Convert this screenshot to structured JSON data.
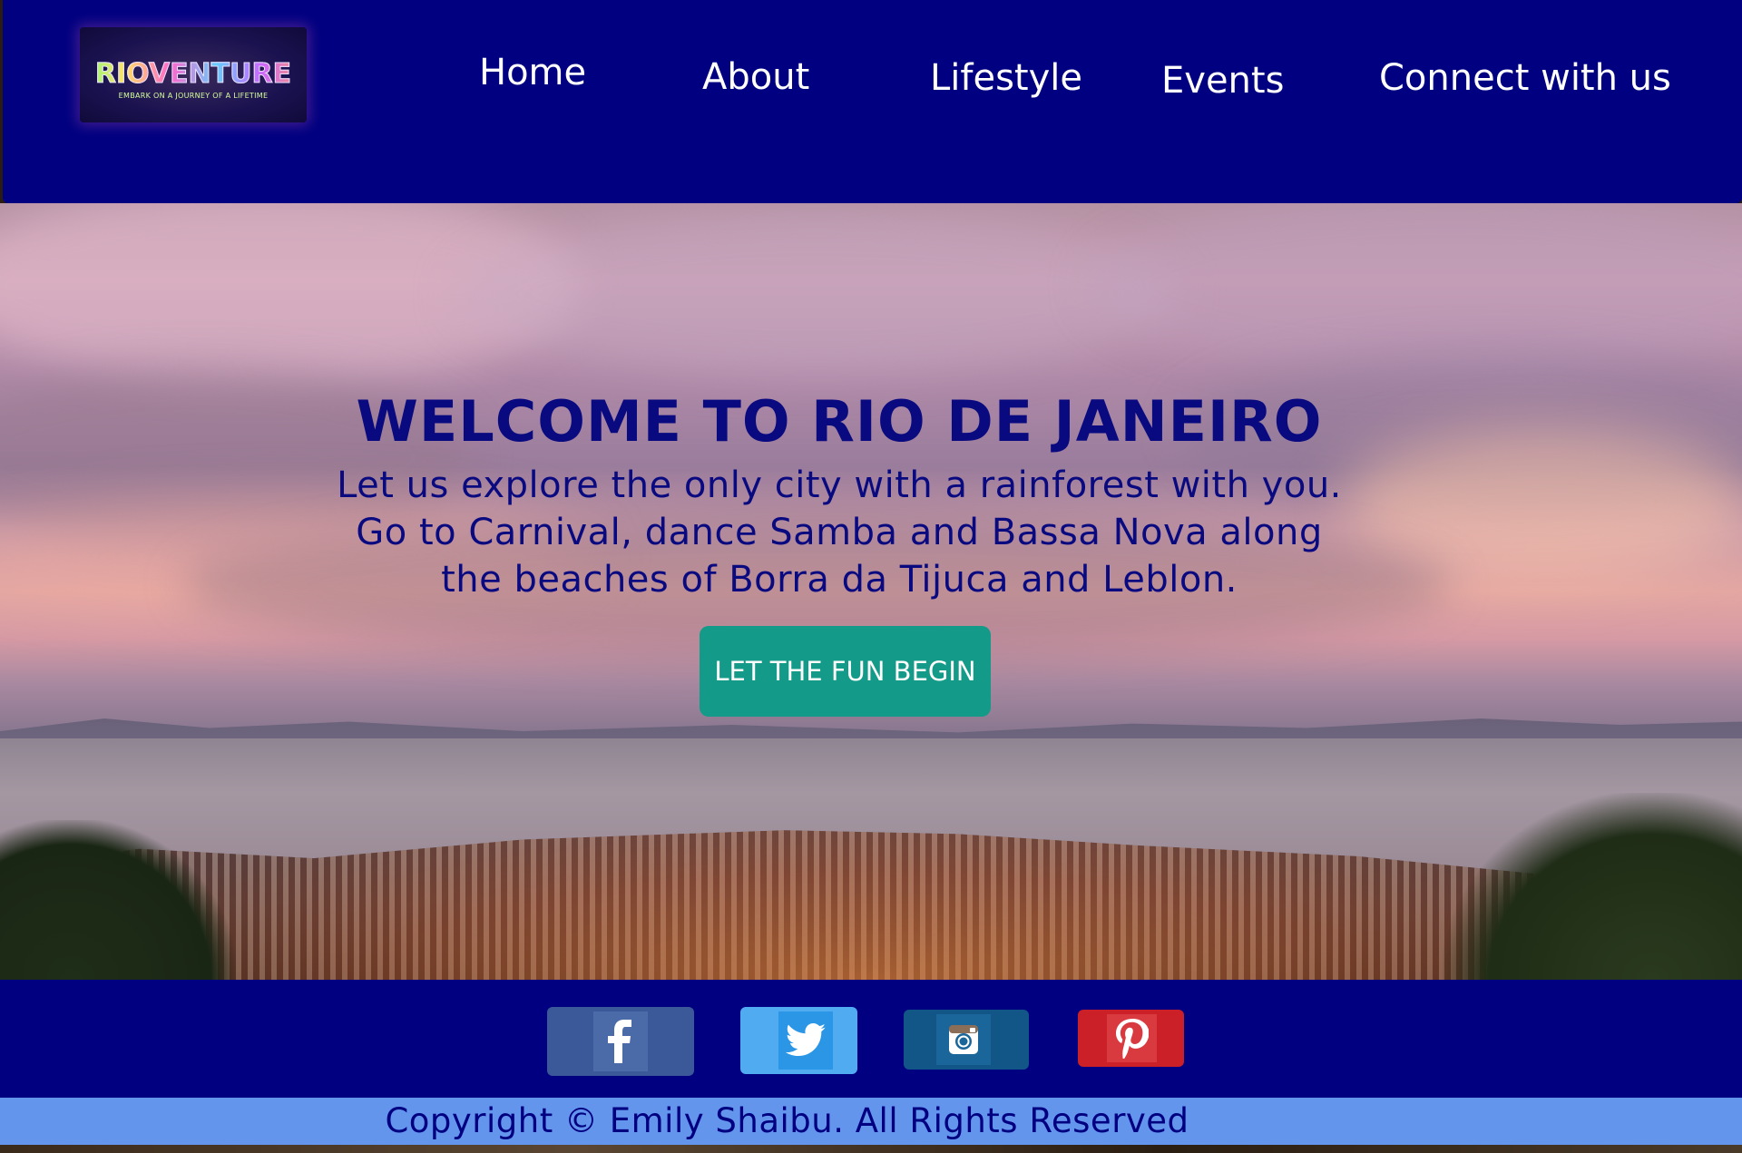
{
  "header": {
    "logo": {
      "title": "RIOVENTURE",
      "tagline": "EMBARK ON A JOURNEY OF A LIFETIME"
    },
    "nav": [
      {
        "label": "Home"
      },
      {
        "label": "About"
      },
      {
        "label": "Lifestyle"
      },
      {
        "label": "Events"
      },
      {
        "label": "Connect with us"
      }
    ]
  },
  "hero": {
    "title": "WELCOME TO RIO DE JANEIRO",
    "lines": [
      "Let us explore the only city with a rainforest with you.",
      "Go to Carnival, dance Samba and Bassa Nova along",
      "the beaches of Borra da Tijuca and Leblon."
    ],
    "cta_label": "LET THE FUN BEGIN"
  },
  "social": [
    {
      "name": "facebook",
      "icon": "facebook-icon",
      "color": "#3b5998"
    },
    {
      "name": "twitter",
      "icon": "twitter-icon",
      "color": "#50abf1"
    },
    {
      "name": "instagram",
      "icon": "instagram-icon",
      "color": "#125688"
    },
    {
      "name": "pinterest",
      "icon": "pinterest-icon",
      "color": "#cb2027"
    }
  ],
  "footer": {
    "copyright": "Copyright © Emily Shaibu. All Rights Reserved"
  },
  "colors": {
    "header_bg": "#000080",
    "footer_bg": "#6495ed",
    "cta_bg": "#149a88",
    "hero_text": "#0a0a80"
  }
}
